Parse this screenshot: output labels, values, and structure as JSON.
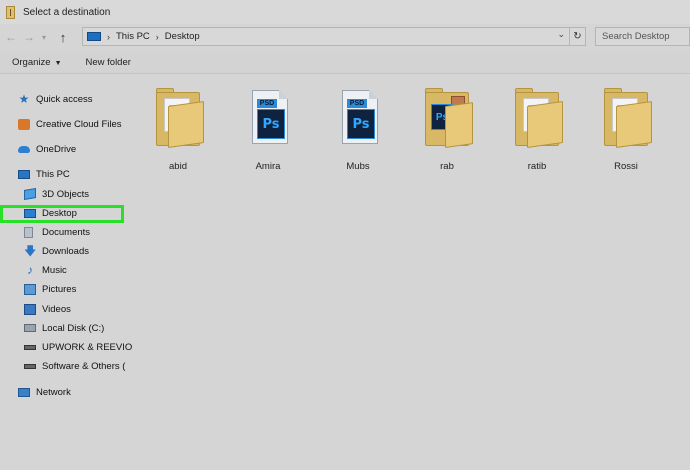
{
  "window": {
    "title": "Select a destination"
  },
  "address": {
    "crumbs": [
      "This PC",
      "Desktop"
    ],
    "search_placeholder": "Search Desktop"
  },
  "commands": {
    "organize": "Organize",
    "new_folder": "New folder"
  },
  "nav": {
    "quick_access": "Quick access",
    "creative_cloud": "Creative Cloud Files",
    "onedrive": "OneDrive",
    "this_pc": "This PC",
    "objects3d": "3D Objects",
    "desktop": "Desktop",
    "documents": "Documents",
    "downloads": "Downloads",
    "music": "Music",
    "pictures": "Pictures",
    "videos": "Videos",
    "local_disk": "Local Disk (C:)",
    "upwork": "UPWORK & REEVIO",
    "software": "Software & Others (",
    "network": "Network"
  },
  "files": [
    {
      "name": "abid",
      "icon": "folder-icon"
    },
    {
      "name": "Amira",
      "icon": "psd-file-icon"
    },
    {
      "name": "Mubs",
      "icon": "psd-file-icon"
    },
    {
      "name": "rab",
      "icon": "folder-icon"
    },
    {
      "name": "ratib",
      "icon": "folder-icon"
    },
    {
      "name": "Rossi",
      "icon": "folder-icon"
    }
  ],
  "colors": {
    "selection_highlight": "#28e028",
    "accent": "#2a74c4"
  }
}
